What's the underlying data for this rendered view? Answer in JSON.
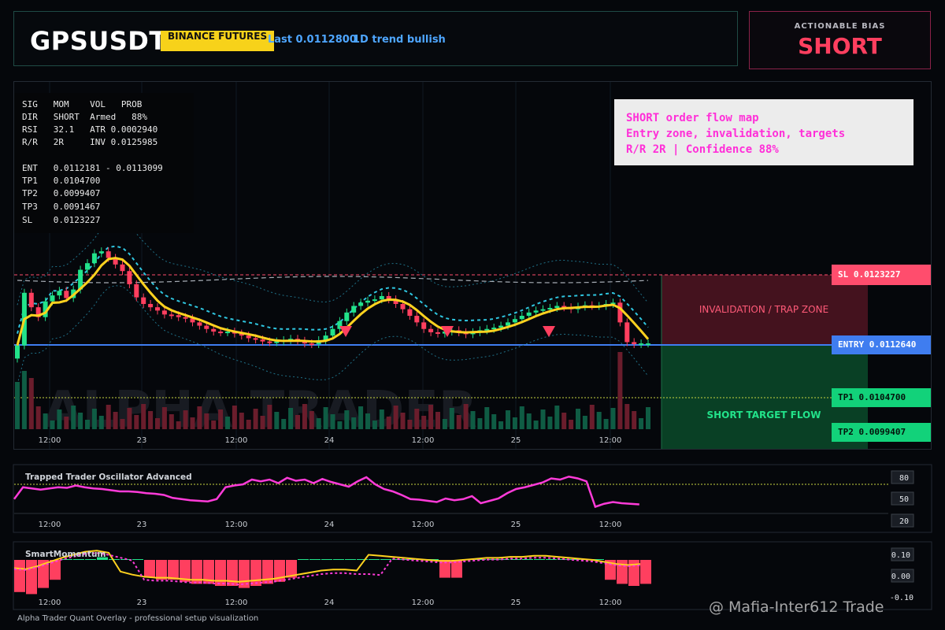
{
  "header": {
    "ticker": "GPSUSDT",
    "exchange_badge": "BINANCE FUTURES",
    "last": "Last 0.0112800",
    "trend": "1D trend bullish"
  },
  "bias": {
    "label": "ACTIONABLE BIAS",
    "value": "SHORT",
    "color": "#ff3f5f"
  },
  "stats_rows": [
    "SIG   MOM    VOL   PROB",
    "DIR   SHORT  Armed   88%",
    "RSI   32.1   ATR 0.0002940",
    "R/R   2R     INV 0.0125985",
    "",
    "ENT   0.0112181 - 0.0113099",
    "TP1   0.0104700",
    "TP2   0.0099407",
    "TP3   0.0091467",
    "SL    0.0123227"
  ],
  "note_lines": [
    "SHORT order flow map",
    "Entry zone, invalidation, targets",
    "R/R 2R | Confidence 88%"
  ],
  "levels": {
    "sl": "SL 0.0123227",
    "entry": "ENTRY 0.0112640",
    "tp1": "TP1 0.0104700",
    "tp2": "TP2 0.0099407"
  },
  "zones": {
    "invalidation": "INVALIDATION / TRAP ZONE",
    "target": "SHORT TARGET FLOW"
  },
  "watermark_big": "ALPHA TRADER",
  "x_ticks": [
    "12:00",
    "23",
    "12:00",
    "24",
    "12:00",
    "25",
    "12:00"
  ],
  "oscillator": {
    "title": "Trapped Trader Oscillator Advanced",
    "axis": [
      "80",
      "50",
      "20"
    ]
  },
  "momentum": {
    "title": "SmartMomentum",
    "axis": [
      "0.10",
      "0.00",
      "-0.10"
    ]
  },
  "footer": "Alpha Trader Quant Overlay - professional setup visualization",
  "watermark_social": "@ Mafia-Inter612 Trade",
  "colors": {
    "sl": "#ff4d6d",
    "entry": "#3f7df0",
    "tp": "#00d37f",
    "bull": "#22e38a",
    "bear": "#ff3f5f",
    "sma": "#ffd21f",
    "osc": "#ff3bd9"
  },
  "chart_data": {
    "type": "candlestick",
    "closes": [
      0.01125,
      0.01205,
      0.01183,
      0.01168,
      0.01192,
      0.01201,
      0.01208,
      0.01197,
      0.0121,
      0.0124,
      0.0125,
      0.01265,
      0.01268,
      0.01258,
      0.01248,
      0.01238,
      0.01218,
      0.01198,
      0.01188,
      0.01183,
      0.01178,
      0.01172,
      0.01171,
      0.01168,
      0.01166,
      0.0116,
      0.01155,
      0.0115,
      0.01146,
      0.01145,
      0.01146,
      0.01143,
      0.0114,
      0.01136,
      0.01134,
      0.01131,
      0.0113,
      0.01131,
      0.01133,
      0.01135,
      0.01132,
      0.01128,
      0.01127,
      0.01133,
      0.0114,
      0.0115,
      0.01162,
      0.01175,
      0.01185,
      0.0119,
      0.01193,
      0.01195,
      0.012,
      0.01195,
      0.01188,
      0.0118,
      0.0117,
      0.0116,
      0.0115,
      0.01145,
      0.01143,
      0.01146,
      0.01148,
      0.01145,
      0.01142,
      0.01145,
      0.01148,
      0.0115,
      0.01152,
      0.01155,
      0.0116,
      0.01165,
      0.0117,
      0.01175,
      0.01178,
      0.0118,
      0.01182,
      0.01185,
      0.01183,
      0.0118,
      0.01184,
      0.01186,
      0.01185,
      0.01185,
      0.01188,
      0.0119,
      0.0116,
      0.0113,
      0.01127,
      0.01128,
      0.01128
    ],
    "sl": 0.0123227,
    "entry": 0.011264,
    "tp1": 0.01047,
    "tp2": 0.0099407,
    "oscillator_levels": [
      80,
      50,
      20
    ],
    "oscillator_values": [
      55,
      75,
      73,
      71,
      73,
      75,
      74,
      78,
      75,
      73,
      72,
      70,
      68,
      68,
      67,
      65,
      64,
      62,
      57,
      55,
      53,
      52,
      51,
      55,
      75,
      78,
      80,
      88,
      85,
      88,
      82,
      91,
      86,
      88,
      82,
      89,
      84,
      80,
      76,
      85,
      92,
      80,
      72,
      68,
      62,
      55,
      54,
      52,
      50,
      56,
      53,
      55,
      60,
      48,
      52,
      56,
      65,
      72,
      75,
      79,
      83,
      90,
      88,
      93,
      90,
      85,
      42,
      47,
      50,
      48,
      47,
      46
    ],
    "momentum_values": [
      -0.08,
      -0.09,
      -0.06,
      -0.02,
      0.02,
      0.05,
      0.08,
      0.09,
      0.07,
      0.04,
      0.01,
      -0.01,
      -0.02,
      -0.02,
      -0.03,
      -0.04,
      -0.04,
      -0.05,
      -0.05,
      -0.06,
      -0.05,
      -0.04,
      -0.03,
      -0.01,
      0.01,
      0.03,
      0.05,
      0.06,
      0.06,
      0.05,
      0.05,
      0.04,
      0.03,
      0.02,
      0.01,
      0.0,
      -0.01,
      -0.01,
      0.0,
      0.01,
      0.02,
      0.02,
      0.03,
      0.03,
      0.04,
      0.04,
      0.03,
      0.02,
      0.01,
      0.0,
      -0.02,
      -0.04,
      -0.05,
      -0.04
    ]
  }
}
